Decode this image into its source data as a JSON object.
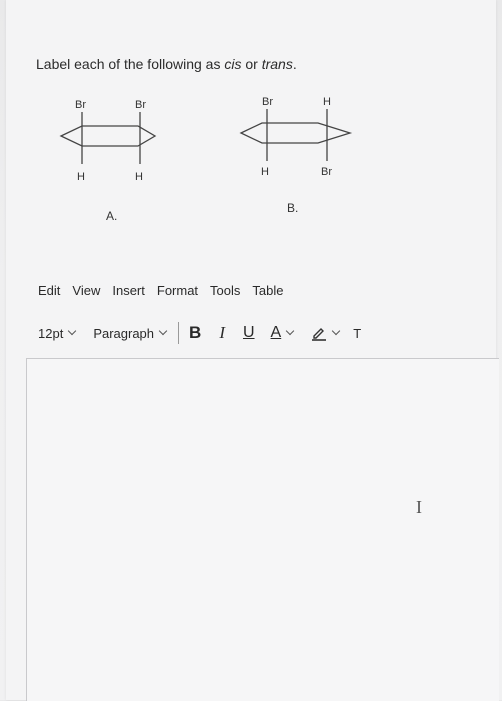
{
  "question": {
    "prefix": "Label each of the following as ",
    "cis": "cis",
    "middle": " or ",
    "trans": "trans",
    "suffix": "."
  },
  "molecule_a": {
    "top_left": "Br",
    "top_right": "Br",
    "bottom_left": "H",
    "bottom_right": "H",
    "caption": "A."
  },
  "molecule_b": {
    "top_left": "Br",
    "top_right": "H",
    "bottom_left": "H",
    "bottom_right": "Br",
    "caption": "B."
  },
  "menu": [
    "Edit",
    "View",
    "Insert",
    "Format",
    "Tools",
    "Table"
  ],
  "toolbar": {
    "font_size": "12pt",
    "block_format": "Paragraph",
    "bold": "B",
    "italic": "I",
    "underline": "U",
    "text_color": "A",
    "highlight_icon": "pencil-icon",
    "overflow": "T"
  },
  "editor": {
    "content": ""
  }
}
